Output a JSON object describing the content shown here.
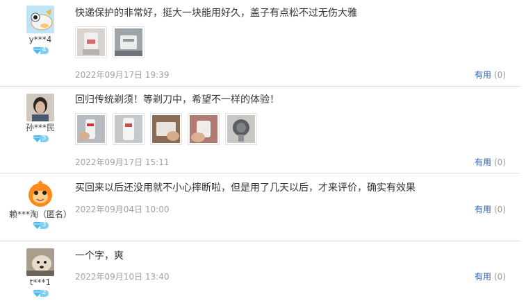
{
  "reviews": [
    {
      "username": "y***4",
      "level": "4",
      "avatar": "cartoon-animal-avatar",
      "text": "快递保护的非常好，挺大一块能用好久，盖子有点松不过无伤大雅",
      "images": [
        "product-photo-1",
        "product-photo-2"
      ],
      "date": "2022年09月17日  19:39",
      "useful_label": "有用",
      "useful_count": "(0)"
    },
    {
      "username": "孙***民",
      "level": "5",
      "avatar": "person-photo-avatar",
      "text": "回归传统剃须！等剃刀中，希望不一样的体验！",
      "images": [
        "product-photo-1",
        "product-photo-2",
        "product-photo-3",
        "product-photo-4",
        "product-photo-5"
      ],
      "date": "2022年09月17日  15:11",
      "useful_label": "有用",
      "useful_count": "(0)"
    },
    {
      "username": "赖***淘（匿名）",
      "level": "3",
      "avatar": "orange-mascot-avatar",
      "text": "买回来以后还没用就不小心摔断啦，但是用了几天以后，才来评价，确实有效果",
      "images": [],
      "date": "2022年09月04日  10:00",
      "useful_label": "有用",
      "useful_count": "(0)"
    },
    {
      "username": "t***1",
      "level": "2",
      "avatar": "dog-photo-avatar",
      "text": "一个字，爽",
      "images": [],
      "date": "2022年09月10日  13:40",
      "useful_label": "有用",
      "useful_count": "(0)"
    }
  ],
  "colors": {
    "link": "#2a5db0",
    "date": "#a0a0a0",
    "badge": "#7ccff2",
    "divider": "#dedede"
  }
}
